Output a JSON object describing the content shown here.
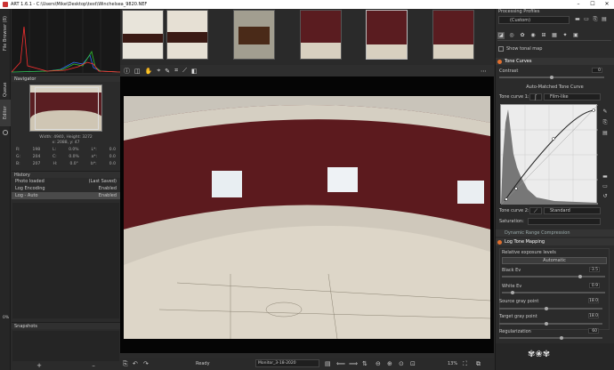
{
  "window": {
    "title": "ART 1.6.1 - C:\\Users\\Mike\\Desktop\\test\\Winchelsea_9820.NEF",
    "min": "–",
    "max": "☐",
    "close": "✕"
  },
  "vtabs": {
    "filebrowser": "File Browser (8)",
    "queue": "Queue",
    "editor": "Editor"
  },
  "navigator": {
    "title": "Navigator",
    "dims": "Width: 4940, Height: 3272",
    "coords": "x: 2088, y: 47",
    "rows": [
      {
        "a": "R:",
        "b": "198",
        "c": "L:",
        "d": "0.0%",
        "e": "L*:",
        "f": "0.0"
      },
      {
        "a": "G:",
        "b": "204",
        "c": "C:",
        "d": "0.0%",
        "e": "a*:",
        "f": "0.0"
      },
      {
        "a": "B:",
        "b": "207",
        "c": "H:",
        "d": "0.0°",
        "e": "b*:",
        "f": "0.0"
      }
    ]
  },
  "history": {
    "title": "History",
    "items": [
      {
        "label": "Photo loaded",
        "value": "(Last Saved)"
      },
      {
        "label": "Log Encoding",
        "value": "Enabled"
      },
      {
        "label": "Log - Auto",
        "value": "Enabled"
      }
    ]
  },
  "snapshots": {
    "title": "Snapshots",
    "add": "+",
    "remove": "–"
  },
  "left_percent": "0%",
  "statusbar": {
    "zoom_label": "Ready",
    "profile": "Monitor_3-18-2020",
    "zoom_value": "13%"
  },
  "right": {
    "profiles_title": "Processing Profiles",
    "profile_value": "(Custom)",
    "show_tonal_map": "Show tonal map",
    "tone_curves": "Tone Curves",
    "contrast_label": "Contrast",
    "contrast_value": "0",
    "auto_matched": "Auto-Matched Tone Curve",
    "tone_curve1_label": "Tone curve 1:",
    "tone_curve1_mode": "Film-like",
    "tone_curve2_label": "Tone curve 2:",
    "tone_curve2_mode": "Standard",
    "saturation_label": "Saturation:",
    "drc": "Dynamic Range Compression",
    "ltm": "Log Tone Mapping",
    "rel_exposure": "Relative exposure levels",
    "automatic": "Automatic",
    "black_ev_label": "Black Ev",
    "black_ev_value": "-3.5",
    "white_ev_label": "White Ev",
    "white_ev_value": "0.9",
    "source_gray_label": "Source gray point",
    "source_gray_value": "18.0",
    "target_gray_label": "Target gray point",
    "target_gray_value": "18.0",
    "regularization_label": "Regularization",
    "regularization_value": "60"
  },
  "colors": {
    "accent": "#e07030",
    "wall": "#5c1a1e"
  }
}
